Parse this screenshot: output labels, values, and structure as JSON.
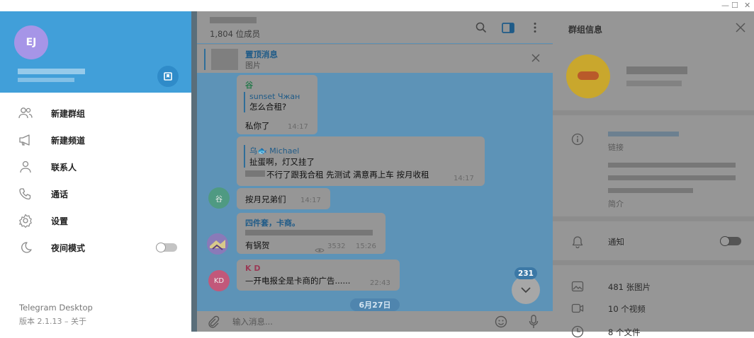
{
  "window": {
    "minimize": "—",
    "maximize": "☐",
    "close": "✕"
  },
  "drawer": {
    "avatar_initials": "EJ",
    "menu": [
      {
        "label": "新建群组",
        "icon": "new-group-icon"
      },
      {
        "label": "新建频道",
        "icon": "new-channel-icon"
      },
      {
        "label": "联系人",
        "icon": "contacts-icon"
      },
      {
        "label": "通话",
        "icon": "calls-icon"
      },
      {
        "label": "设置",
        "icon": "settings-icon"
      },
      {
        "label": "夜间模式",
        "icon": "night-mode-icon",
        "toggle": false
      }
    ],
    "app_name": "Telegram Desktop",
    "version": "版本 2.1.13 – 关于"
  },
  "chat": {
    "members": "1,804 位成员",
    "pinned": {
      "title": "置顶消息",
      "subtitle": "图片"
    },
    "messages": [
      {
        "author": "谷",
        "reply_name": "sunset Чжан",
        "reply_text": "怎么合租?",
        "text": "私你了",
        "time": "14:17"
      },
      {
        "reply_name": "乌🐟 Michael",
        "reply_text": "扯蛋啊，灯又挂了",
        "text": "不行了跟我合租 先测试 满意再上车 按月收租",
        "time": "14:17"
      },
      {
        "avatar": "谷",
        "text": "按月兄弟们",
        "time": "14:17"
      },
      {
        "author": "四件套，卡商。",
        "text": "有锅贺",
        "views": "3532",
        "time": "15:26"
      },
      {
        "author": "K D",
        "avatar": "KD",
        "text": "—开电报全是卡商的广告......",
        "time": "22:43"
      }
    ],
    "date_pill": "6月27日",
    "unread_count": "231",
    "composer_placeholder": "输入消息..."
  },
  "info": {
    "title": "群组信息",
    "link_label": "链接",
    "about_label": "简介",
    "notifications_label": "通知",
    "notifications_on": false,
    "media": [
      {
        "label": "481 张图片",
        "icon": "photos-icon"
      },
      {
        "label": "10 个视频",
        "icon": "videos-icon"
      },
      {
        "label": "8 个文件",
        "icon": "files-icon"
      }
    ]
  }
}
